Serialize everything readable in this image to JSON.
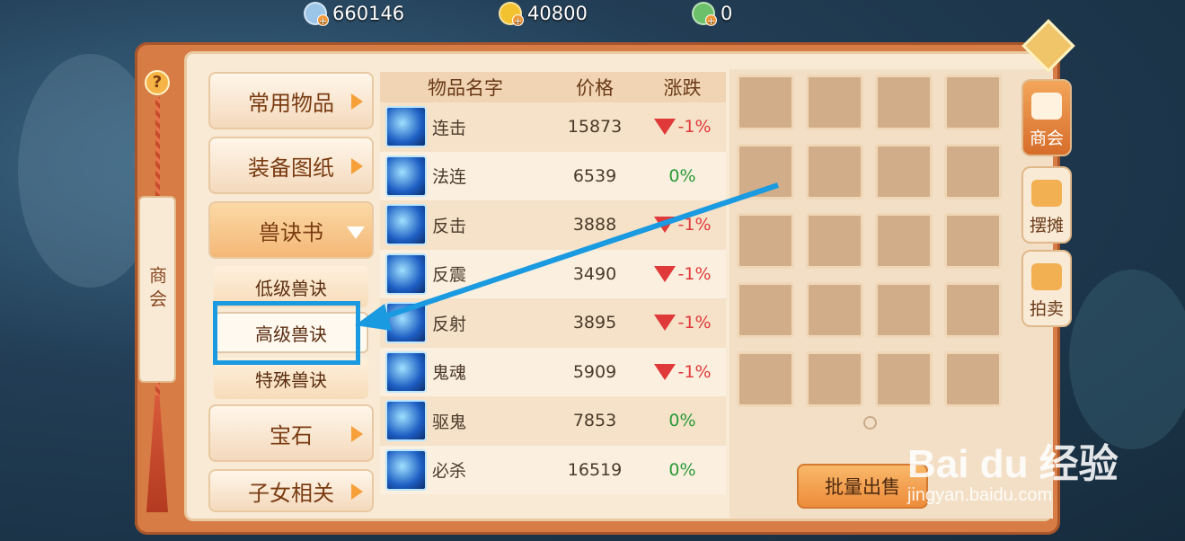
{
  "currency": [
    {
      "icon": "silver-coin-icon",
      "value": "660146"
    },
    {
      "icon": "gold-coin-icon",
      "value": "40800"
    },
    {
      "icon": "jade-coin-icon",
      "value": "0"
    }
  ],
  "left_tab": {
    "label": "商会"
  },
  "categories": [
    {
      "label": "常用物品"
    },
    {
      "label": "装备图纸"
    },
    {
      "label": "兽诀书"
    },
    {
      "label": "宝石"
    },
    {
      "label": "子女相关"
    }
  ],
  "subcategories": [
    {
      "label": "低级兽诀"
    },
    {
      "label": "高级兽诀"
    },
    {
      "label": "特殊兽诀"
    }
  ],
  "table": {
    "headers": {
      "name": "物品名字",
      "price": "价格",
      "change": "涨跌"
    },
    "rows": [
      {
        "name": "连击",
        "price": "15873",
        "change": "-1%",
        "trend": "down"
      },
      {
        "name": "法连",
        "price": "6539",
        "change": "0%",
        "trend": "flat"
      },
      {
        "name": "反击",
        "price": "3888",
        "change": "-1%",
        "trend": "down"
      },
      {
        "name": "反震",
        "price": "3490",
        "change": "-1%",
        "trend": "down"
      },
      {
        "name": "反射",
        "price": "3895",
        "change": "-1%",
        "trend": "down"
      },
      {
        "name": "鬼魂",
        "price": "5909",
        "change": "-1%",
        "trend": "down"
      },
      {
        "name": "驱鬼",
        "price": "7853",
        "change": "0%",
        "trend": "flat"
      },
      {
        "name": "必杀",
        "price": "16519",
        "change": "0%",
        "trend": "flat"
      }
    ]
  },
  "batch_sell": {
    "label": "批量出售"
  },
  "right_tabs": [
    {
      "label": "商会",
      "icon": "market-icon"
    },
    {
      "label": "摆摊",
      "icon": "stall-icon"
    },
    {
      "label": "拍卖",
      "icon": "auction-icon"
    }
  ],
  "watermark": {
    "brand": "Bai du 经验",
    "url": "jingyan.baidu.com"
  },
  "colors": {
    "accent_blue": "#1a9ae0",
    "down_red": "#e0393a",
    "flat_green": "#2a9a36",
    "panel_orange": "#d77c45"
  }
}
